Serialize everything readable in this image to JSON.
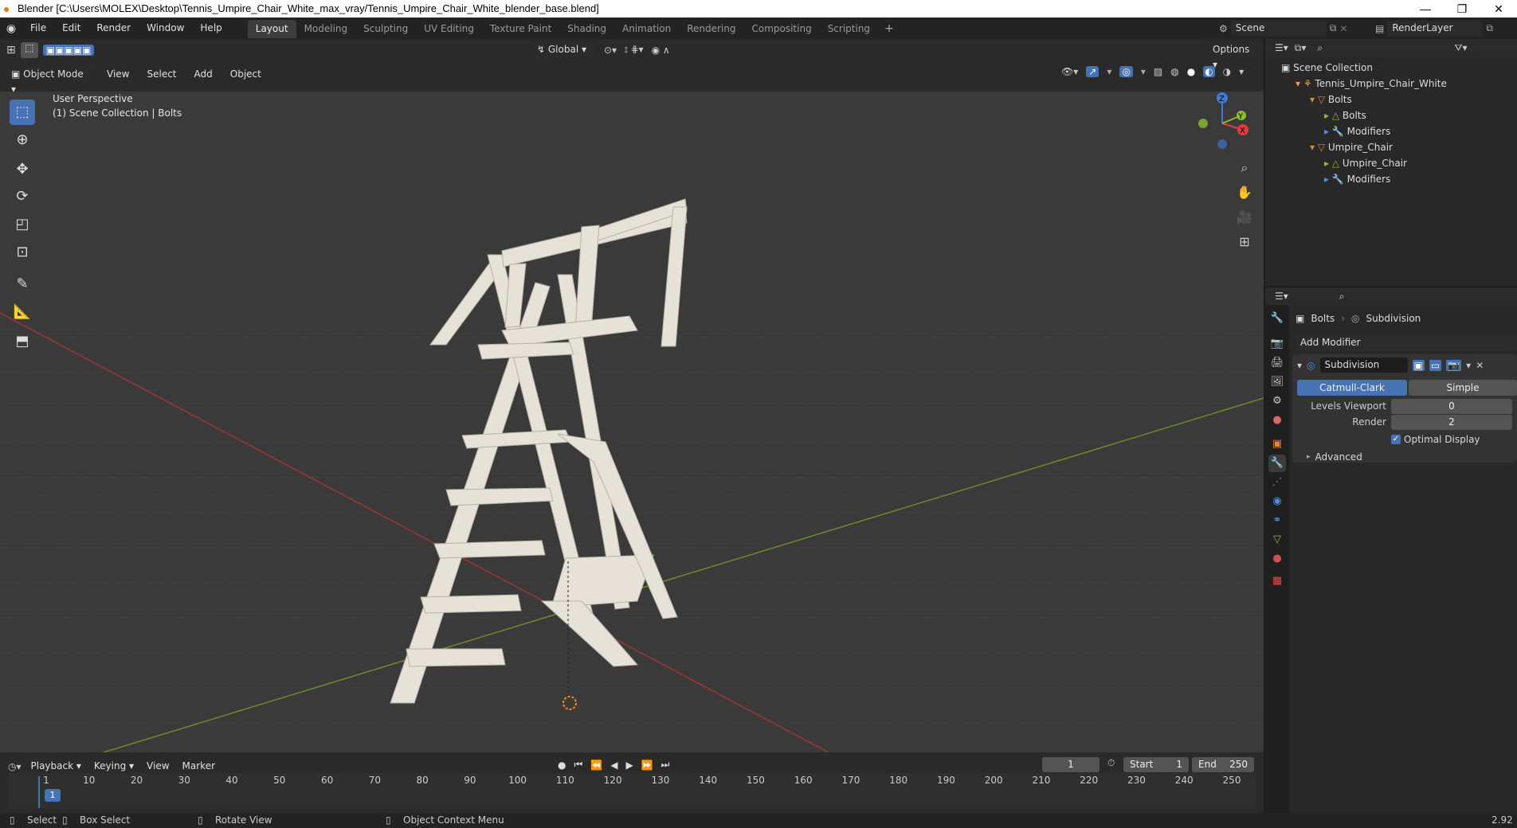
{
  "window": {
    "title": "Blender [C:\\Users\\MOLEX\\Desktop\\Tennis_Umpire_Chair_White_max_vray/Tennis_Umpire_Chair_White_blender_base.blend]",
    "min": "—",
    "max": "❐",
    "close": "✕"
  },
  "menu": [
    "File",
    "Edit",
    "Render",
    "Window",
    "Help"
  ],
  "workspaces": [
    "Layout",
    "Modeling",
    "Sculpting",
    "UV Editing",
    "Texture Paint",
    "Shading",
    "Animation",
    "Rendering",
    "Compositing",
    "Scripting"
  ],
  "scene": "Scene",
  "render_layer": "RenderLayer",
  "header": {
    "transform": "Global",
    "options": "Options",
    "mode": "Object Mode",
    "menus": [
      "View",
      "Select",
      "Add",
      "Object"
    ]
  },
  "viewport": {
    "perspective": "User Perspective",
    "collection": "(1) Scene Collection | Bolts",
    "axes": {
      "z": "Z",
      "x": "X",
      "y": "Y"
    }
  },
  "outliner": {
    "root": "Scene Collection",
    "items": [
      {
        "label": "Tennis_Umpire_Chair_White",
        "indent": 1
      },
      {
        "label": "Bolts",
        "indent": 2
      },
      {
        "label": "Bolts",
        "indent": 3
      },
      {
        "label": "Modifiers",
        "indent": 3
      },
      {
        "label": "Umpire_Chair",
        "indent": 2
      },
      {
        "label": "Umpire_Chair",
        "indent": 3
      },
      {
        "label": "Modifiers",
        "indent": 3
      }
    ]
  },
  "properties": {
    "object": "Bolts",
    "modifier_tab": "Subdivision",
    "add_modifier": "Add Modifier",
    "modifier_name": "Subdivision",
    "mode_a": "Catmull-Clark",
    "mode_b": "Simple",
    "levels_label": "Levels Viewport",
    "levels_value": "0",
    "render_label": "Render",
    "render_value": "2",
    "optimal": "Optimal Display",
    "advanced": "Advanced"
  },
  "timeline": {
    "menus": [
      "Playback",
      "Keying",
      "View",
      "Marker"
    ],
    "current": "1",
    "start_label": "Start",
    "start": "1",
    "end_label": "End",
    "end": "250",
    "ticks": [
      "1",
      "10",
      "20",
      "30",
      "40",
      "50",
      "60",
      "70",
      "80",
      "90",
      "100",
      "110",
      "120",
      "130",
      "140",
      "150",
      "160",
      "170",
      "180",
      "190",
      "200",
      "210",
      "220",
      "230",
      "240",
      "250"
    ]
  },
  "status": {
    "select": "Select",
    "box": "Box Select",
    "rotate": "Rotate View",
    "context": "Object Context Menu",
    "version": "2.92"
  },
  "colors": {
    "accent": "#4772b3",
    "x_axis": "#e63b3b",
    "y_axis": "#8bbd2e",
    "z_axis": "#3d7bd8"
  }
}
